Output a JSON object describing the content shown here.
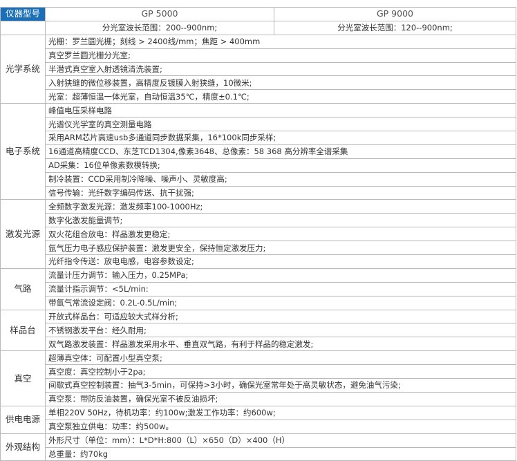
{
  "header": {
    "label": "仪器型号",
    "models": [
      "GP 5000",
      "GP 9000"
    ]
  },
  "wavelength": [
    "分光室波长范围：200--900nm;",
    "分光室波长范围：120--900nm;"
  ],
  "sections": [
    {
      "category": "光学系统",
      "items": [
        "光栅：罗兰圆光栅；刻线 > 2400线/mm；焦距 > 400mm",
        "真空罗兰圆光栅分光室;",
        "半潜式真空室入射透镜清洗装置;",
        "入射狭缝的微位移装置，高精度反镀膜入射狭缝，10微米;",
        "光室：超薄恒温一体光室，自动恒温35℃，精度±0.1℃;"
      ]
    },
    {
      "category": "电子系统",
      "items": [
        "峰值电压采样电路",
        "光谱仪光学室的真空测量电路",
        "采用ARM芯片高速usb多通道同步数据采集，16*100k同步采样;",
        "16通道高精度CCD、东芝TCD1304,像素3648、总像素：58 368 高分辨率全谱采集",
        "AD采集：16位单像素数模转换;",
        "制冷装置：CCD采用制冷降噪、噪声小、灵敏度高;",
        "信号传输：光纤数字编码传送、抗干扰强;"
      ]
    },
    {
      "category": "激发光源",
      "items": [
        "全频数字激发光源：激发频率100-1000Hz;",
        "数字化激发能量调节;",
        "双火花组合放电：样品激发更稳定;",
        "氩气压力电子感应保护装置：激发更安全，保持恒定激发压力;",
        "光纤指令传送：放电电感，电容参数设定;"
      ]
    },
    {
      "category": "气路",
      "items": [
        "流量计压力调节：输入压力，0.25MPa;",
        "流量计指示调节：<5L/min:",
        "带氩气常流设定阀：0.2L-0.5L/min;"
      ]
    },
    {
      "category": "样品台",
      "items": [
        "开放式样品台：可适应较大式样分析;",
        "不锈钢激发平台：经久耐用;",
        "双气路激发装置：样品激发采用水平、垂直双气路，有利于样品的稳定激发;"
      ]
    },
    {
      "category": "真空",
      "items": [
        "超薄真空体：可配置小型真空泵;",
        "真空度：真空控制小于2pa;",
        "间歇式真空控制装置：抽气3-5min，可保持>3小时，确保光室常年处于高灵敏状态，避免油气污染;",
        "真空泵：带防反油装置，确保光室不被反油损坏;"
      ]
    },
    {
      "category": "供电电源",
      "items": [
        "单相220V 50Hz，待机功率：约100w;激发工作功率：约600w;",
        "真空泵独立供电：功率：约500w。"
      ]
    },
    {
      "category": "外观结构",
      "items": [
        "外形尺寸（单位：mm）：L*D*H:800（L）×650（D）×400（H）",
        "总重量：约70kg"
      ]
    }
  ]
}
